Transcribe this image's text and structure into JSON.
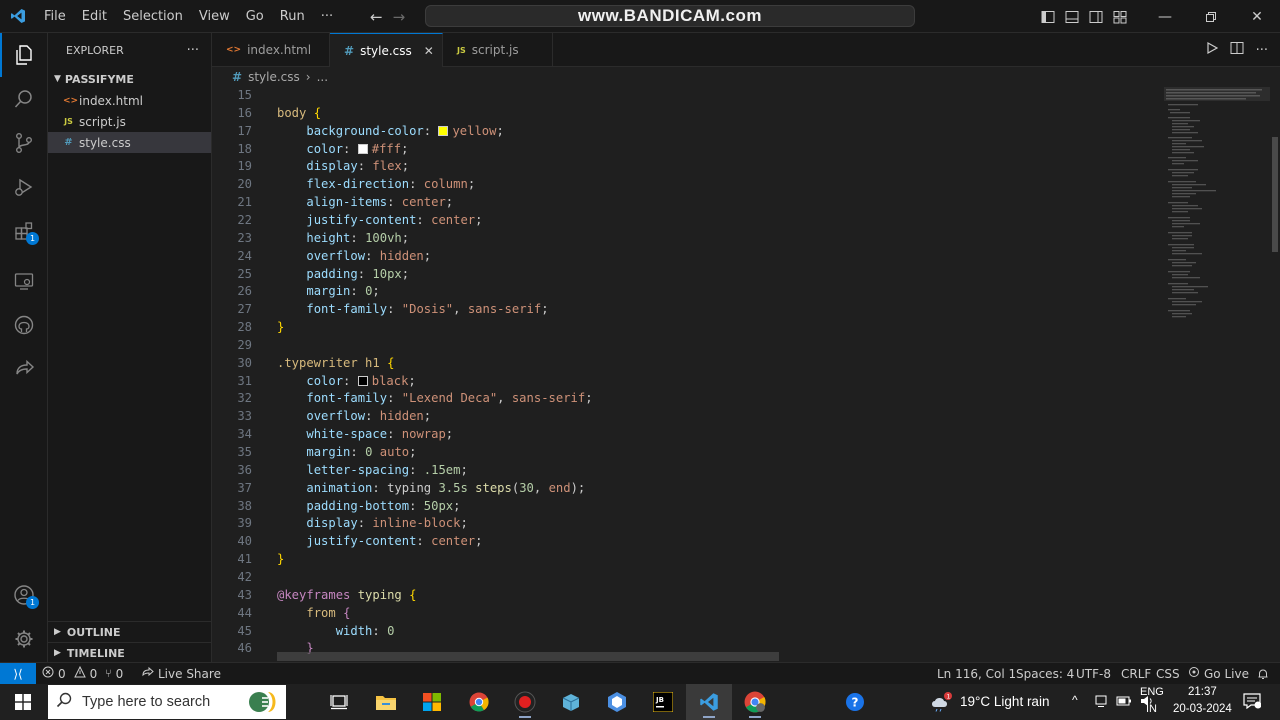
{
  "titlebar": {
    "menu": [
      "File",
      "Edit",
      "Selection",
      "View",
      "Go",
      "Run",
      "···"
    ],
    "command_center_text": "www.BANDICAM.com"
  },
  "explorer": {
    "title": "EXPLORER",
    "more": "···",
    "folder": "PASSIFYME",
    "files": [
      {
        "icon": "<>",
        "name": "index.html",
        "icon_color": "#e37933"
      },
      {
        "icon": "JS",
        "name": "script.js",
        "icon_color": "#cbcb41"
      },
      {
        "icon": "#",
        "name": "style.css",
        "icon_color": "#519aba"
      }
    ],
    "outline": "OUTLINE",
    "timeline": "TIMELINE"
  },
  "tabs": [
    {
      "icon": "<>",
      "label": "index.html",
      "icon_color": "#e37933"
    },
    {
      "icon": "#",
      "label": "style.css",
      "icon_color": "#519aba",
      "close": "✕"
    },
    {
      "icon": "JS",
      "label": "script.js",
      "icon_color": "#cbcb41"
    }
  ],
  "breadcrumb": {
    "icon": "#",
    "file": "style.css",
    "sep": "›",
    "more": "..."
  },
  "code": {
    "lines": [
      {
        "n": "15",
        "tokens": []
      },
      {
        "n": "16",
        "tokens": [
          {
            "t": "body",
            "c": "c-sel"
          },
          {
            "t": " ",
            "c": "c-punc"
          },
          {
            "t": "{",
            "c": "c-brace"
          }
        ]
      },
      {
        "n": "17",
        "tokens": [
          {
            "t": "    ",
            "c": "c-punc"
          },
          {
            "t": "background-color",
            "c": "c-prop"
          },
          {
            "t": ": ",
            "c": "c-punc"
          },
          {
            "t": "",
            "c": "swatch",
            "color": "#ffff00"
          },
          {
            "t": "yellow",
            "c": "c-val"
          },
          {
            "t": ";",
            "c": "c-punc"
          }
        ]
      },
      {
        "n": "18",
        "tokens": [
          {
            "t": "    ",
            "c": "c-punc"
          },
          {
            "t": "color",
            "c": "c-prop"
          },
          {
            "t": ": ",
            "c": "c-punc"
          },
          {
            "t": "",
            "c": "swatch",
            "color": "#ffffff"
          },
          {
            "t": "#fff",
            "c": "c-val"
          },
          {
            "t": ";",
            "c": "c-punc"
          }
        ]
      },
      {
        "n": "19",
        "tokens": [
          {
            "t": "    ",
            "c": "c-punc"
          },
          {
            "t": "display",
            "c": "c-prop"
          },
          {
            "t": ": ",
            "c": "c-punc"
          },
          {
            "t": "flex",
            "c": "c-val"
          },
          {
            "t": ";",
            "c": "c-punc"
          }
        ]
      },
      {
        "n": "20",
        "tokens": [
          {
            "t": "    ",
            "c": "c-punc"
          },
          {
            "t": "flex-direction",
            "c": "c-prop"
          },
          {
            "t": ": ",
            "c": "c-punc"
          },
          {
            "t": "column",
            "c": "c-val"
          },
          {
            "t": ";",
            "c": "c-punc"
          }
        ]
      },
      {
        "n": "21",
        "tokens": [
          {
            "t": "    ",
            "c": "c-punc"
          },
          {
            "t": "align-items",
            "c": "c-prop"
          },
          {
            "t": ": ",
            "c": "c-punc"
          },
          {
            "t": "center",
            "c": "c-val"
          },
          {
            "t": ";",
            "c": "c-punc"
          }
        ]
      },
      {
        "n": "22",
        "tokens": [
          {
            "t": "    ",
            "c": "c-punc"
          },
          {
            "t": "justify-content",
            "c": "c-prop"
          },
          {
            "t": ": ",
            "c": "c-punc"
          },
          {
            "t": "center",
            "c": "c-val"
          },
          {
            "t": ";",
            "c": "c-punc"
          }
        ]
      },
      {
        "n": "23",
        "tokens": [
          {
            "t": "    ",
            "c": "c-punc"
          },
          {
            "t": "height",
            "c": "c-prop"
          },
          {
            "t": ": ",
            "c": "c-punc"
          },
          {
            "t": "100vh",
            "c": "c-num"
          },
          {
            "t": ";",
            "c": "c-punc"
          }
        ]
      },
      {
        "n": "24",
        "tokens": [
          {
            "t": "    ",
            "c": "c-punc"
          },
          {
            "t": "overflow",
            "c": "c-prop"
          },
          {
            "t": ": ",
            "c": "c-punc"
          },
          {
            "t": "hidden",
            "c": "c-val"
          },
          {
            "t": ";",
            "c": "c-punc"
          }
        ]
      },
      {
        "n": "25",
        "tokens": [
          {
            "t": "    ",
            "c": "c-punc"
          },
          {
            "t": "padding",
            "c": "c-prop"
          },
          {
            "t": ": ",
            "c": "c-punc"
          },
          {
            "t": "10px",
            "c": "c-num"
          },
          {
            "t": ";",
            "c": "c-punc"
          }
        ]
      },
      {
        "n": "26",
        "tokens": [
          {
            "t": "    ",
            "c": "c-punc"
          },
          {
            "t": "margin",
            "c": "c-prop"
          },
          {
            "t": ": ",
            "c": "c-punc"
          },
          {
            "t": "0",
            "c": "c-num"
          },
          {
            "t": ";",
            "c": "c-punc"
          }
        ]
      },
      {
        "n": "27",
        "tokens": [
          {
            "t": "    ",
            "c": "c-punc"
          },
          {
            "t": "font-family",
            "c": "c-prop"
          },
          {
            "t": ": ",
            "c": "c-punc"
          },
          {
            "t": "\"Dosis\"",
            "c": "c-val"
          },
          {
            "t": ", ",
            "c": "c-punc"
          },
          {
            "t": "sans-serif",
            "c": "c-val"
          },
          {
            "t": ";",
            "c": "c-punc"
          }
        ]
      },
      {
        "n": "28",
        "tokens": [
          {
            "t": "}",
            "c": "c-brace"
          }
        ]
      },
      {
        "n": "29",
        "tokens": []
      },
      {
        "n": "30",
        "tokens": [
          {
            "t": ".typewriter h1",
            "c": "c-sel"
          },
          {
            "t": " ",
            "c": "c-punc"
          },
          {
            "t": "{",
            "c": "c-brace"
          }
        ]
      },
      {
        "n": "31",
        "tokens": [
          {
            "t": "    ",
            "c": "c-punc"
          },
          {
            "t": "color",
            "c": "c-prop"
          },
          {
            "t": ": ",
            "c": "c-punc"
          },
          {
            "t": "",
            "c": "swatch",
            "color": "#000000"
          },
          {
            "t": "black",
            "c": "c-val"
          },
          {
            "t": ";",
            "c": "c-punc"
          }
        ]
      },
      {
        "n": "32",
        "tokens": [
          {
            "t": "    ",
            "c": "c-punc"
          },
          {
            "t": "font-family",
            "c": "c-prop"
          },
          {
            "t": ": ",
            "c": "c-punc"
          },
          {
            "t": "\"Lexend Deca\"",
            "c": "c-val"
          },
          {
            "t": ", ",
            "c": "c-punc"
          },
          {
            "t": "sans-serif",
            "c": "c-val"
          },
          {
            "t": ";",
            "c": "c-punc"
          }
        ]
      },
      {
        "n": "33",
        "tokens": [
          {
            "t": "    ",
            "c": "c-punc"
          },
          {
            "t": "overflow",
            "c": "c-prop"
          },
          {
            "t": ": ",
            "c": "c-punc"
          },
          {
            "t": "hidden",
            "c": "c-val"
          },
          {
            "t": ";",
            "c": "c-punc"
          }
        ]
      },
      {
        "n": "34",
        "tokens": [
          {
            "t": "    ",
            "c": "c-punc"
          },
          {
            "t": "white-space",
            "c": "c-prop"
          },
          {
            "t": ": ",
            "c": "c-punc"
          },
          {
            "t": "nowrap",
            "c": "c-val"
          },
          {
            "t": ";",
            "c": "c-punc"
          }
        ]
      },
      {
        "n": "35",
        "tokens": [
          {
            "t": "    ",
            "c": "c-punc"
          },
          {
            "t": "margin",
            "c": "c-prop"
          },
          {
            "t": ": ",
            "c": "c-punc"
          },
          {
            "t": "0",
            "c": "c-num"
          },
          {
            "t": " ",
            "c": "c-punc"
          },
          {
            "t": "auto",
            "c": "c-val"
          },
          {
            "t": ";",
            "c": "c-punc"
          }
        ]
      },
      {
        "n": "36",
        "tokens": [
          {
            "t": "    ",
            "c": "c-punc"
          },
          {
            "t": "letter-spacing",
            "c": "c-prop"
          },
          {
            "t": ": ",
            "c": "c-punc"
          },
          {
            "t": ".15em",
            "c": "c-num"
          },
          {
            "t": ";",
            "c": "c-punc"
          }
        ]
      },
      {
        "n": "37",
        "tokens": [
          {
            "t": "    ",
            "c": "c-punc"
          },
          {
            "t": "animation",
            "c": "c-prop"
          },
          {
            "t": ": ",
            "c": "c-punc"
          },
          {
            "t": "typing ",
            "c": "c-punc"
          },
          {
            "t": "3.5s",
            "c": "c-num"
          },
          {
            "t": " ",
            "c": "c-punc"
          },
          {
            "t": "steps",
            "c": "c-fn"
          },
          {
            "t": "(",
            "c": "c-punc"
          },
          {
            "t": "30",
            "c": "c-num"
          },
          {
            "t": ", ",
            "c": "c-punc"
          },
          {
            "t": "end",
            "c": "c-val"
          },
          {
            "t": ");",
            "c": "c-punc"
          }
        ]
      },
      {
        "n": "38",
        "tokens": [
          {
            "t": "    ",
            "c": "c-punc"
          },
          {
            "t": "padding-bottom",
            "c": "c-prop"
          },
          {
            "t": ": ",
            "c": "c-punc"
          },
          {
            "t": "50px",
            "c": "c-num"
          },
          {
            "t": ";",
            "c": "c-punc"
          }
        ]
      },
      {
        "n": "39",
        "tokens": [
          {
            "t": "    ",
            "c": "c-punc"
          },
          {
            "t": "display",
            "c": "c-prop"
          },
          {
            "t": ": ",
            "c": "c-punc"
          },
          {
            "t": "inline-block",
            "c": "c-val"
          },
          {
            "t": ";",
            "c": "c-punc"
          }
        ]
      },
      {
        "n": "40",
        "tokens": [
          {
            "t": "    ",
            "c": "c-punc"
          },
          {
            "t": "justify-content",
            "c": "c-prop"
          },
          {
            "t": ": ",
            "c": "c-punc"
          },
          {
            "t": "center",
            "c": "c-val"
          },
          {
            "t": ";",
            "c": "c-punc"
          }
        ]
      },
      {
        "n": "41",
        "tokens": [
          {
            "t": "}",
            "c": "c-brace"
          }
        ]
      },
      {
        "n": "42",
        "tokens": []
      },
      {
        "n": "43",
        "tokens": [
          {
            "t": "@keyframes",
            "c": "c-at"
          },
          {
            "t": " ",
            "c": "c-punc"
          },
          {
            "t": "typing",
            "c": "c-kname"
          },
          {
            "t": " ",
            "c": "c-punc"
          },
          {
            "t": "{",
            "c": "c-brace"
          }
        ]
      },
      {
        "n": "44",
        "tokens": [
          {
            "t": "    ",
            "c": "c-punc"
          },
          {
            "t": "from",
            "c": "c-sel"
          },
          {
            "t": " ",
            "c": "c-punc"
          },
          {
            "t": "{",
            "c": "c-at"
          }
        ]
      },
      {
        "n": "45",
        "tokens": [
          {
            "t": "        ",
            "c": "c-punc"
          },
          {
            "t": "width",
            "c": "c-prop"
          },
          {
            "t": ": ",
            "c": "c-punc"
          },
          {
            "t": "0",
            "c": "c-num"
          }
        ]
      },
      {
        "n": "46",
        "tokens": [
          {
            "t": "    ",
            "c": "c-punc"
          },
          {
            "t": "}",
            "c": "c-at"
          }
        ]
      }
    ]
  },
  "statusbar": {
    "remote": "⟩⟨",
    "errors": "0",
    "warnings": "0",
    "ports": "0",
    "live_share": "Live Share",
    "position": "Ln 116, Col 1",
    "spaces": "Spaces: 4",
    "encoding": "UTF-8",
    "eol": "CRLF",
    "language": "CSS",
    "go_live": "Go Live"
  },
  "taskbar": {
    "search_placeholder": "Type here to search",
    "weather": "19°C  Light rain",
    "lang_top": "ENG",
    "lang_bottom": "IN",
    "time": "21:37",
    "date": "20-03-2024",
    "notification_count": "1"
  },
  "badges": {
    "extensions": "1",
    "accounts": "1"
  }
}
